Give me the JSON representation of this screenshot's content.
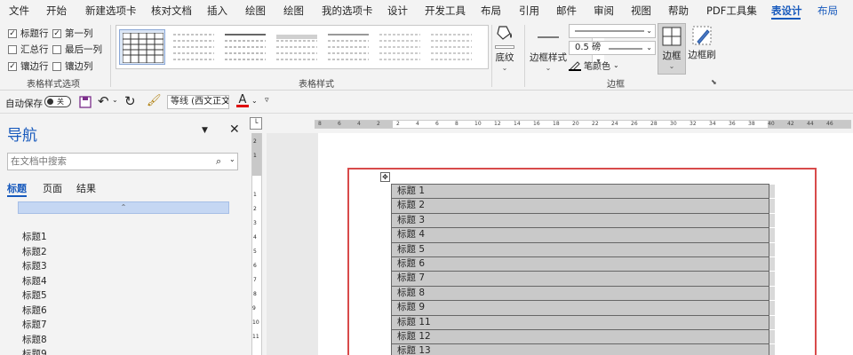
{
  "menubar": {
    "tabs": [
      "文件",
      "开始",
      "新建选项卡",
      "核对文档",
      "插入",
      "绘图",
      "绘图",
      "我的选项卡",
      "设计",
      "开发工具",
      "布局",
      "引用",
      "邮件",
      "审阅",
      "视图",
      "帮助",
      "PDF工具集",
      "表设计",
      "布局"
    ],
    "active_tab": "表设计"
  },
  "ribbon": {
    "style_options": {
      "checkboxes": [
        {
          "label": "标题行",
          "checked": true
        },
        {
          "label": "第一列",
          "checked": true
        },
        {
          "label": "汇总行",
          "checked": false
        },
        {
          "label": "最后一列",
          "checked": false
        },
        {
          "label": "镶边行",
          "checked": true
        },
        {
          "label": "镶边列",
          "checked": false
        }
      ],
      "group_label": "表格样式选项"
    },
    "table_styles": {
      "group_label": "表格样式",
      "shading_label": "底纹"
    },
    "borders": {
      "border_styles_label": "边框样式",
      "weight_value": "0.5 磅",
      "pen_color_label": "笔颜色",
      "borders_label": "边框",
      "painter_label": "边框刷",
      "group_label": "边框"
    }
  },
  "qat": {
    "autosave_label": "自动保存",
    "autosave_state": "关",
    "font_name": "等线 (西文正文)",
    "font_color_glyph": "A"
  },
  "navigation": {
    "title": "导航",
    "search_placeholder": "在文档中搜索",
    "tabs": [
      "标题",
      "页面",
      "结果"
    ],
    "headings": [
      "标题1",
      "标题2",
      "标题3",
      "标题4",
      "标题5",
      "标题6",
      "标题7",
      "标题8",
      "标题9"
    ]
  },
  "ruler": {
    "h_ticks": [
      "8",
      "6",
      "4",
      "2",
      "2",
      "4",
      "6",
      "8",
      "10",
      "12",
      "14",
      "16",
      "18",
      "20",
      "22",
      "24",
      "26",
      "28",
      "30",
      "32",
      "34",
      "36",
      "38",
      "40",
      "42",
      "44",
      "46"
    ],
    "v_ticks": [
      "2",
      "1",
      "1",
      "2",
      "3",
      "4",
      "5",
      "6",
      "7",
      "8",
      "9",
      "10",
      "11"
    ]
  },
  "document": {
    "rows": [
      "标题 1",
      "标题 2",
      "标题 3",
      "标题 4",
      "标题 5",
      "标题 6",
      "标题 7",
      "标题 8",
      "标题 9",
      "标题 11",
      "标题 12",
      "标题 13"
    ]
  },
  "colors": {
    "accent": "#185abd",
    "red_frame": "#d84a4a",
    "table_fill": "#c9c9c9"
  }
}
